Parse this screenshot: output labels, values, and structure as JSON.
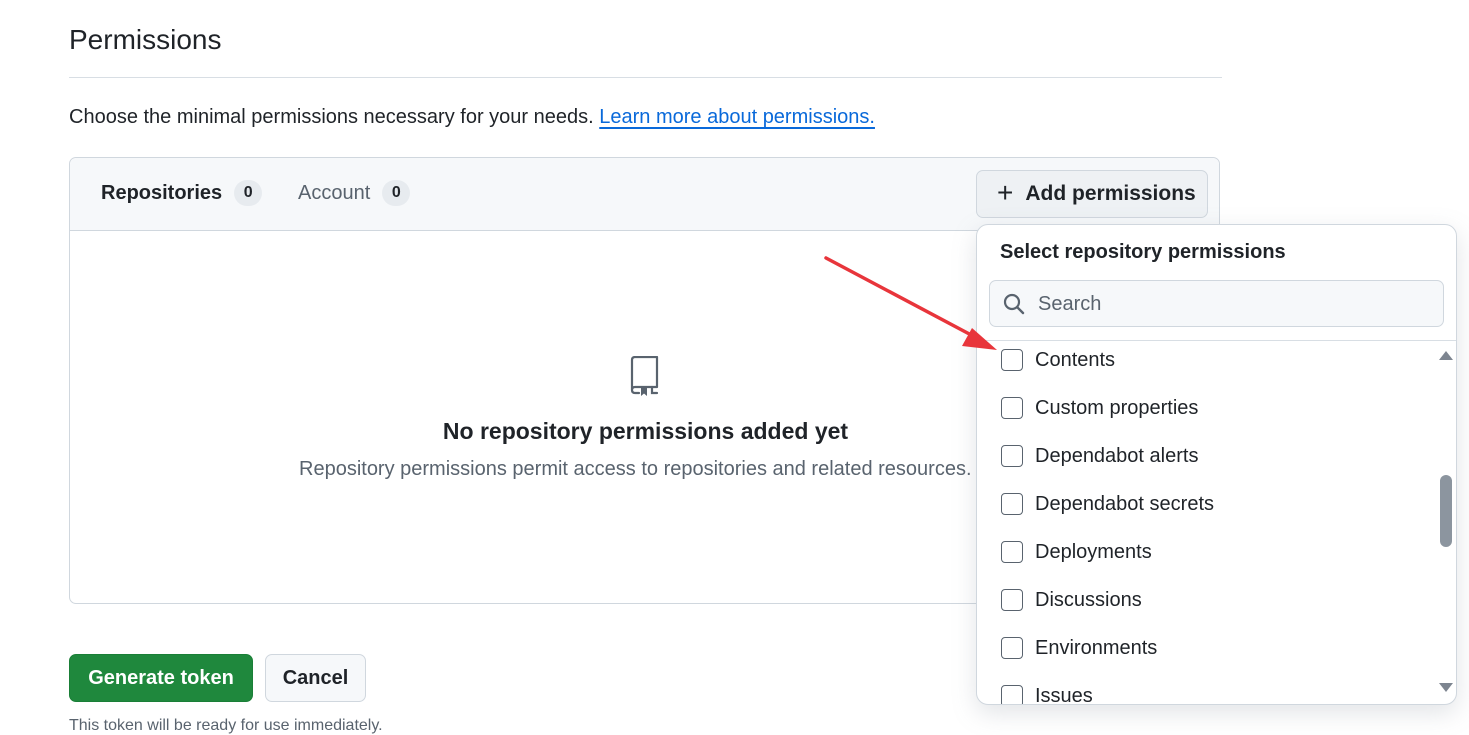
{
  "page": {
    "heading": "Permissions",
    "description": "Choose the minimal permissions necessary for your needs.",
    "learn_more_link": "Learn more about permissions."
  },
  "panel": {
    "tabs": [
      {
        "label": "Repositories",
        "count": "0",
        "selected": true
      },
      {
        "label": "Account",
        "count": "0",
        "selected": false
      }
    ],
    "add_button_label": "Add permissions",
    "empty_state": {
      "icon": "repo-icon",
      "title": "No repository permissions added yet",
      "subtitle": "Repository permissions permit access to repositories and related resources."
    }
  },
  "actions": {
    "generate_label": "Generate token",
    "cancel_label": "Cancel",
    "footnote": "This token will be ready for use immediately."
  },
  "dropdown": {
    "title": "Select repository permissions",
    "search_placeholder": "Search",
    "search_value": "",
    "items": [
      {
        "label": "Contents",
        "checked": false
      },
      {
        "label": "Custom properties",
        "checked": false
      },
      {
        "label": "Dependabot alerts",
        "checked": false
      },
      {
        "label": "Dependabot secrets",
        "checked": false
      },
      {
        "label": "Deployments",
        "checked": false
      },
      {
        "label": "Discussions",
        "checked": false
      },
      {
        "label": "Environments",
        "checked": false
      },
      {
        "label": "Issues",
        "checked": false
      }
    ]
  },
  "annotation": {
    "type": "arrow",
    "color": "#e8353b"
  },
  "colors": {
    "primary_button": "#1f883d",
    "link": "#0969da",
    "annotation_arrow": "#e8353b"
  }
}
